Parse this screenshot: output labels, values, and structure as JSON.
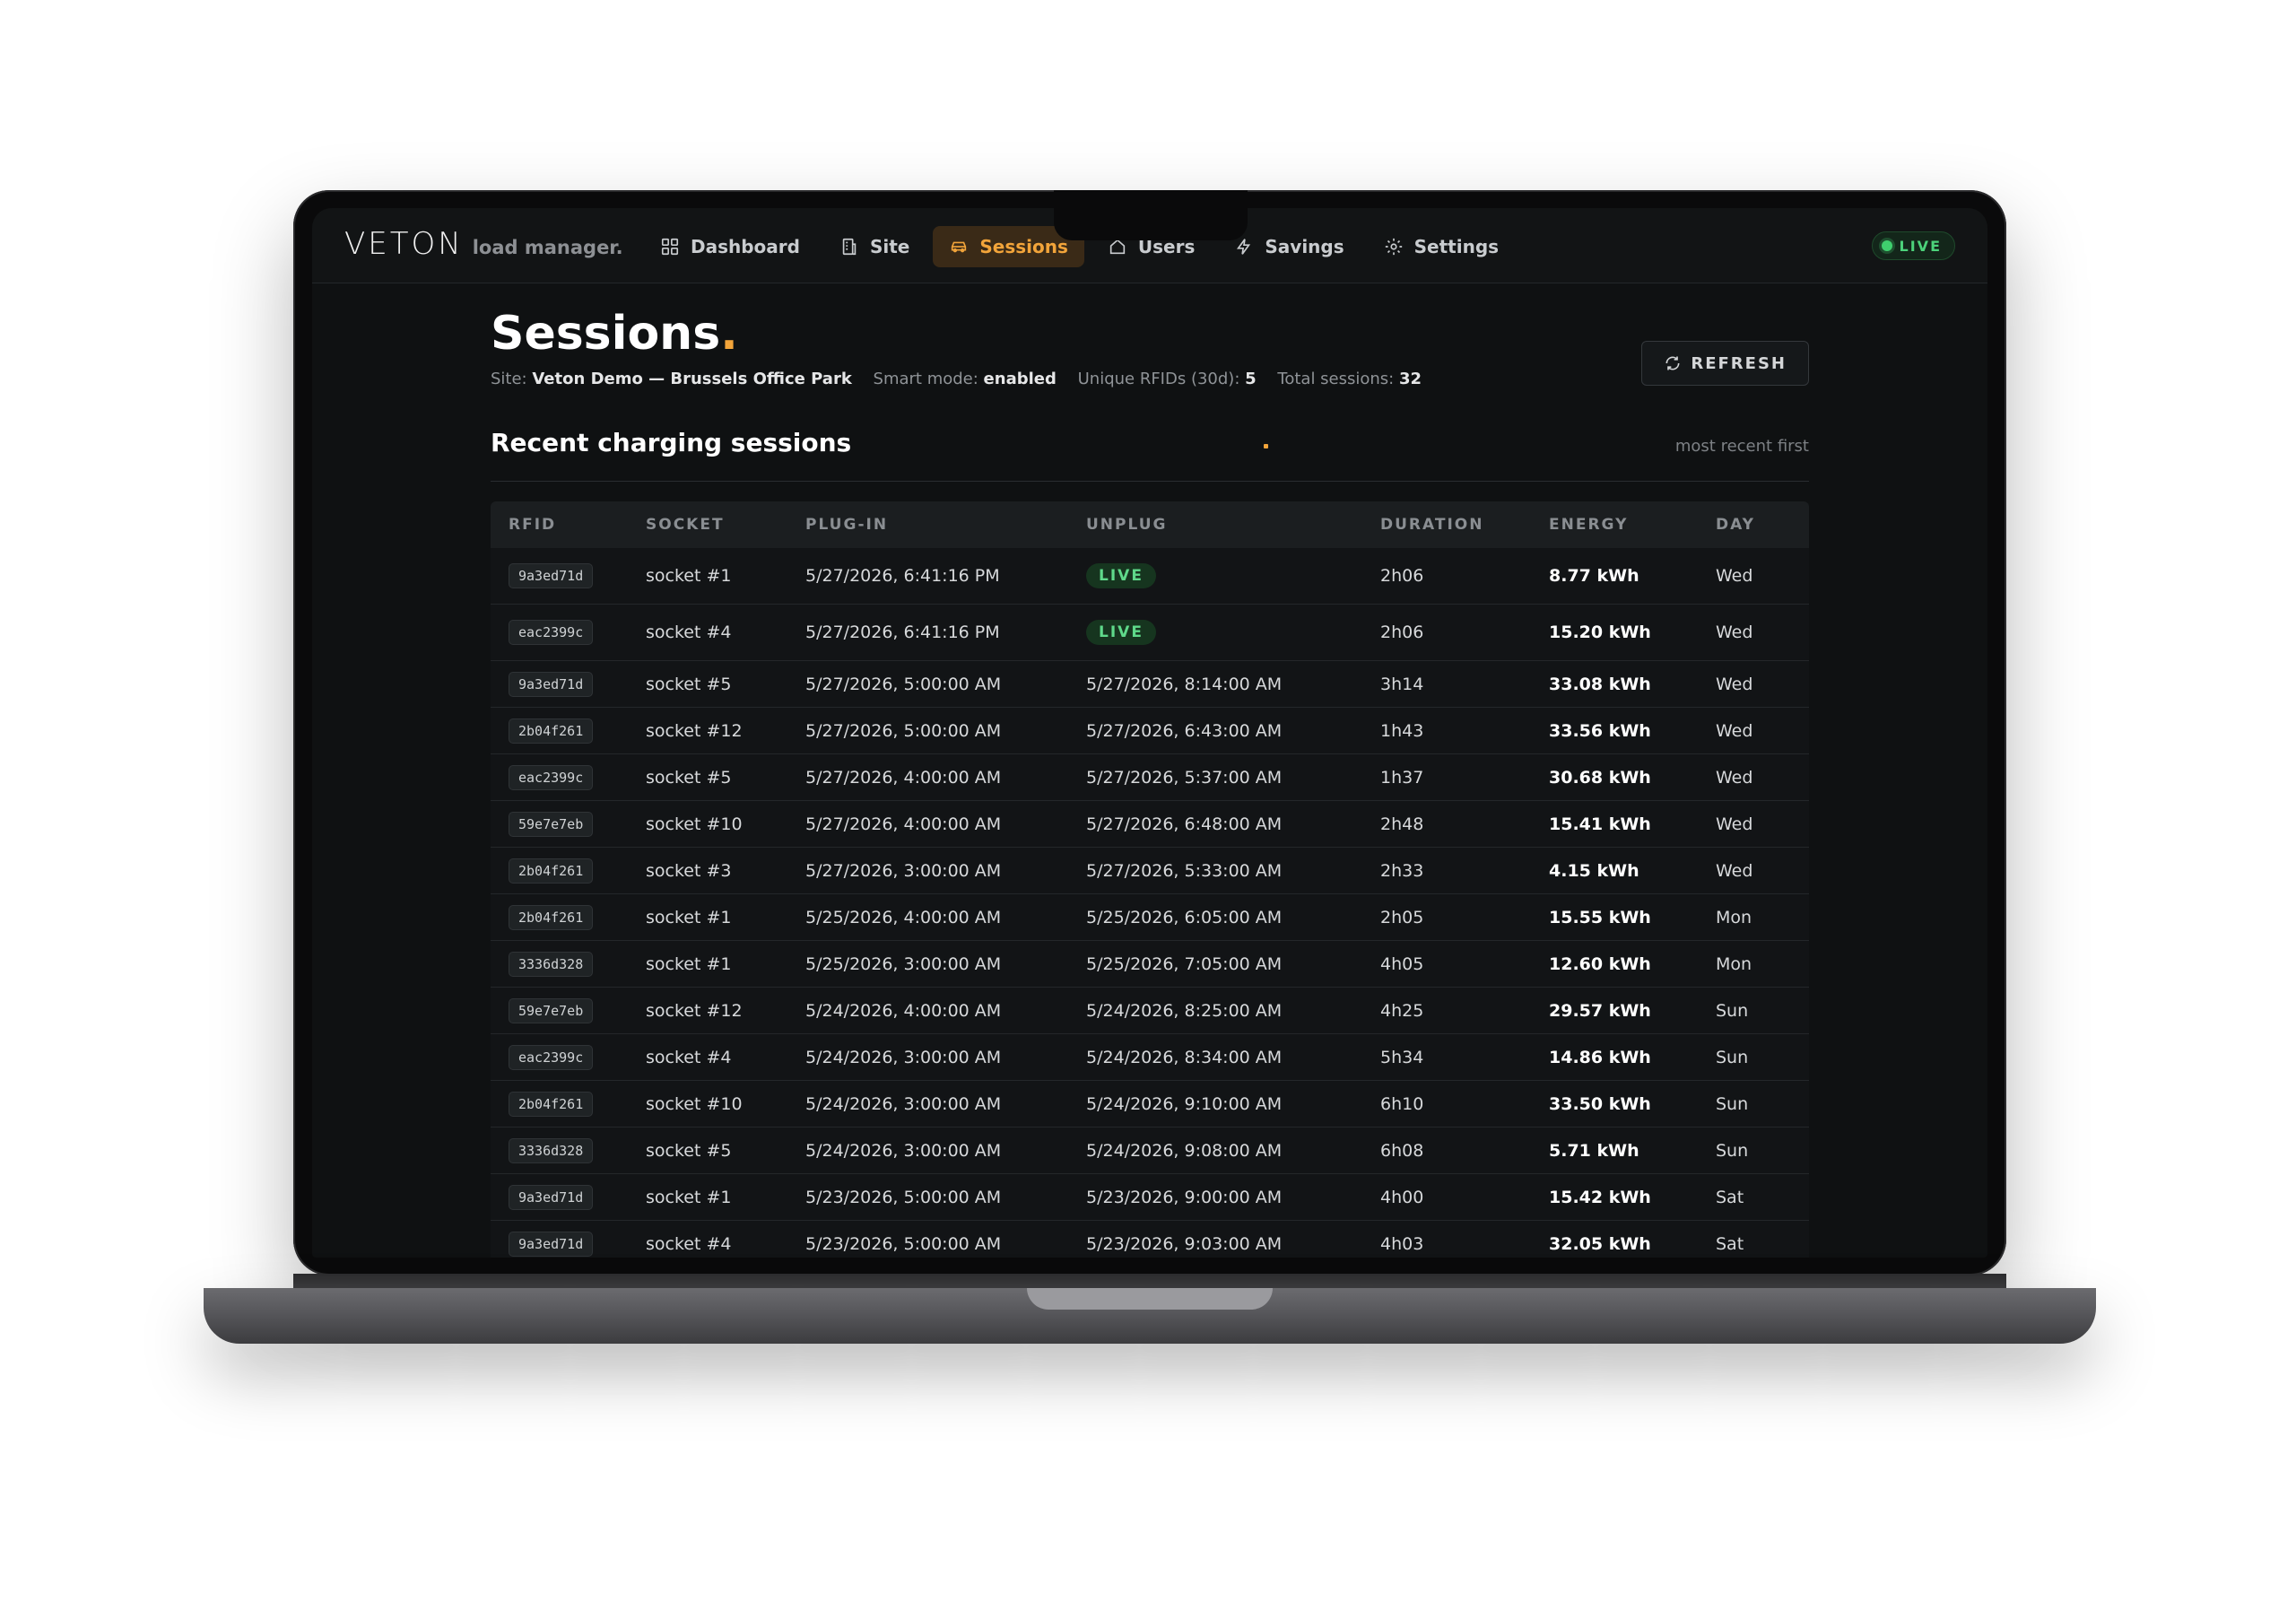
{
  "brand": {
    "word": "VETON",
    "sub": "load manager."
  },
  "nav": {
    "items": [
      {
        "label": "Dashboard",
        "icon": "grid-icon"
      },
      {
        "label": "Site",
        "icon": "building-icon"
      },
      {
        "label": "Sessions",
        "icon": "car-icon",
        "active": true
      },
      {
        "label": "Users",
        "icon": "home-icon"
      },
      {
        "label": "Savings",
        "icon": "bolt-icon"
      },
      {
        "label": "Settings",
        "icon": "gear-icon"
      }
    ],
    "live_label": "LIVE"
  },
  "page": {
    "title": "Sessions",
    "title_dot": ".",
    "site_label": "Site:",
    "site_value": "Veton Demo — Brussels Office Park",
    "smart_label": "Smart mode:",
    "smart_value": "enabled",
    "rfids_label": "Unique RFIDs (30d):",
    "rfids_value": "5",
    "total_label": "Total sessions:",
    "total_value": "32",
    "refresh_label": "REFRESH"
  },
  "section": {
    "title": "Recent charging sessions",
    "hint": "most recent first"
  },
  "table": {
    "headers": [
      "RFID",
      "SOCKET",
      "PLUG-IN",
      "UNPLUG",
      "DURATION",
      "ENERGY",
      "DAY"
    ],
    "rows": [
      {
        "rfid": "9a3ed71d",
        "socket": "socket #1",
        "plug": "5/27/2026, 6:41:16 PM",
        "unplug": "LIVE",
        "live": true,
        "duration": "2h06",
        "energy": "8.77 kWh",
        "day": "Wed"
      },
      {
        "rfid": "eac2399c",
        "socket": "socket #4",
        "plug": "5/27/2026, 6:41:16 PM",
        "unplug": "LIVE",
        "live": true,
        "duration": "2h06",
        "energy": "15.20 kWh",
        "day": "Wed"
      },
      {
        "rfid": "9a3ed71d",
        "socket": "socket #5",
        "plug": "5/27/2026, 5:00:00 AM",
        "unplug": "5/27/2026, 8:14:00 AM",
        "duration": "3h14",
        "energy": "33.08 kWh",
        "day": "Wed"
      },
      {
        "rfid": "2b04f261",
        "socket": "socket #12",
        "plug": "5/27/2026, 5:00:00 AM",
        "unplug": "5/27/2026, 6:43:00 AM",
        "duration": "1h43",
        "energy": "33.56 kWh",
        "day": "Wed"
      },
      {
        "rfid": "eac2399c",
        "socket": "socket #5",
        "plug": "5/27/2026, 4:00:00 AM",
        "unplug": "5/27/2026, 5:37:00 AM",
        "duration": "1h37",
        "energy": "30.68 kWh",
        "day": "Wed"
      },
      {
        "rfid": "59e7e7eb",
        "socket": "socket #10",
        "plug": "5/27/2026, 4:00:00 AM",
        "unplug": "5/27/2026, 6:48:00 AM",
        "duration": "2h48",
        "energy": "15.41 kWh",
        "day": "Wed"
      },
      {
        "rfid": "2b04f261",
        "socket": "socket #3",
        "plug": "5/27/2026, 3:00:00 AM",
        "unplug": "5/27/2026, 5:33:00 AM",
        "duration": "2h33",
        "energy": "4.15 kWh",
        "day": "Wed"
      },
      {
        "rfid": "2b04f261",
        "socket": "socket #1",
        "plug": "5/25/2026, 4:00:00 AM",
        "unplug": "5/25/2026, 6:05:00 AM",
        "duration": "2h05",
        "energy": "15.55 kWh",
        "day": "Mon"
      },
      {
        "rfid": "3336d328",
        "socket": "socket #1",
        "plug": "5/25/2026, 3:00:00 AM",
        "unplug": "5/25/2026, 7:05:00 AM",
        "duration": "4h05",
        "energy": "12.60 kWh",
        "day": "Mon"
      },
      {
        "rfid": "59e7e7eb",
        "socket": "socket #12",
        "plug": "5/24/2026, 4:00:00 AM",
        "unplug": "5/24/2026, 8:25:00 AM",
        "duration": "4h25",
        "energy": "29.57 kWh",
        "day": "Sun"
      },
      {
        "rfid": "eac2399c",
        "socket": "socket #4",
        "plug": "5/24/2026, 3:00:00 AM",
        "unplug": "5/24/2026, 8:34:00 AM",
        "duration": "5h34",
        "energy": "14.86 kWh",
        "day": "Sun"
      },
      {
        "rfid": "2b04f261",
        "socket": "socket #10",
        "plug": "5/24/2026, 3:00:00 AM",
        "unplug": "5/24/2026, 9:10:00 AM",
        "duration": "6h10",
        "energy": "33.50 kWh",
        "day": "Sun"
      },
      {
        "rfid": "3336d328",
        "socket": "socket #5",
        "plug": "5/24/2026, 3:00:00 AM",
        "unplug": "5/24/2026, 9:08:00 AM",
        "duration": "6h08",
        "energy": "5.71 kWh",
        "day": "Sun"
      },
      {
        "rfid": "9a3ed71d",
        "socket": "socket #1",
        "plug": "5/23/2026, 5:00:00 AM",
        "unplug": "5/23/2026, 9:00:00 AM",
        "duration": "4h00",
        "energy": "15.42 kWh",
        "day": "Sat"
      },
      {
        "rfid": "9a3ed71d",
        "socket": "socket #4",
        "plug": "5/23/2026, 5:00:00 AM",
        "unplug": "5/23/2026, 9:03:00 AM",
        "duration": "4h03",
        "energy": "32.05 kWh",
        "day": "Sat"
      }
    ]
  },
  "colors": {
    "accent": "#f2a43a",
    "live": "#4cd27a",
    "background": "#0f1112"
  }
}
